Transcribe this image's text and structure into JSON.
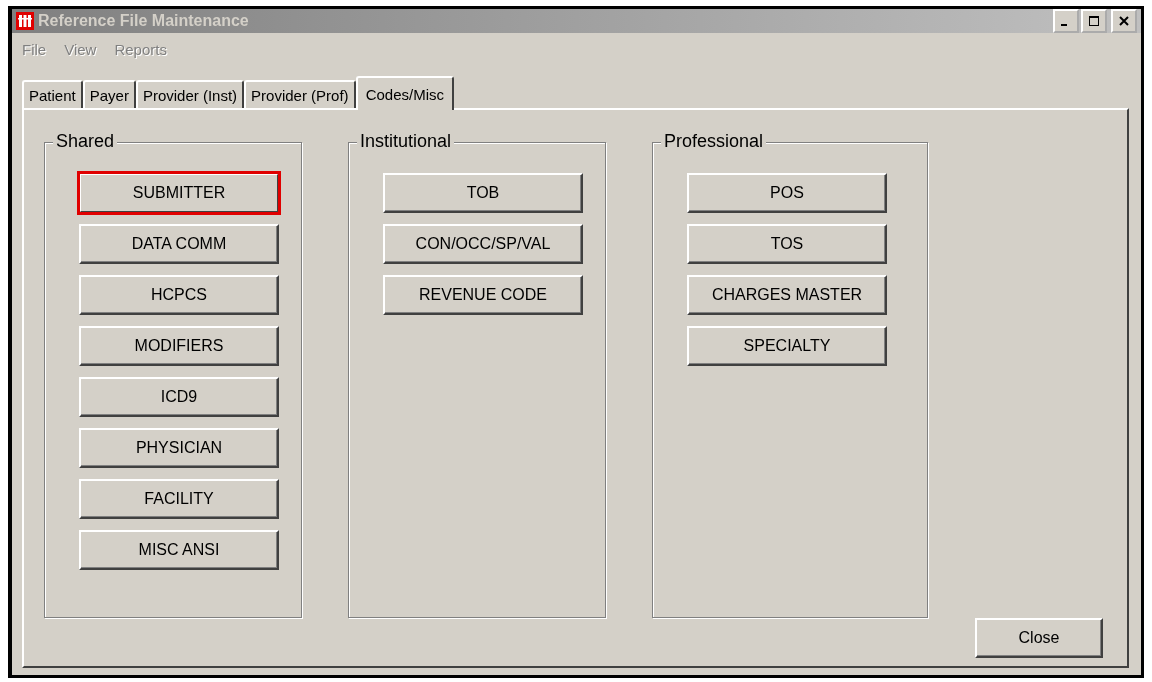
{
  "window": {
    "title": "Reference File Maintenance",
    "active": false
  },
  "menu": [
    {
      "label": "File",
      "disabled": true
    },
    {
      "label": "View",
      "disabled": true
    },
    {
      "label": "Reports",
      "disabled": true
    }
  ],
  "tabs": [
    {
      "label": "Patient",
      "selected": false
    },
    {
      "label": "Payer",
      "selected": false
    },
    {
      "label": "Provider (Inst)",
      "selected": false
    },
    {
      "label": "Provider (Prof)",
      "selected": false
    },
    {
      "label": "Codes/Misc",
      "selected": true
    }
  ],
  "groups": [
    {
      "title": "Shared",
      "buttons": [
        {
          "label": "SUBMITTER",
          "focused": true
        },
        {
          "label": "DATA COMM",
          "focused": false
        },
        {
          "label": "HCPCS",
          "focused": false
        },
        {
          "label": "MODIFIERS",
          "focused": false
        },
        {
          "label": "ICD9",
          "focused": false
        },
        {
          "label": "PHYSICIAN",
          "focused": false
        },
        {
          "label": "FACILITY",
          "focused": false
        },
        {
          "label": "MISC ANSI",
          "focused": false
        }
      ]
    },
    {
      "title": "Institutional",
      "buttons": [
        {
          "label": "TOB",
          "focused": false
        },
        {
          "label": "CON/OCC/SP/VAL",
          "focused": false
        },
        {
          "label": "REVENUE CODE",
          "focused": false
        }
      ]
    },
    {
      "title": "Professional",
      "buttons": [
        {
          "label": "POS",
          "focused": false
        },
        {
          "label": "TOS",
          "focused": false
        },
        {
          "label": "CHARGES MASTER",
          "focused": false
        },
        {
          "label": "SPECIALTY",
          "focused": false
        }
      ]
    }
  ],
  "close_button": {
    "label": "Close"
  }
}
